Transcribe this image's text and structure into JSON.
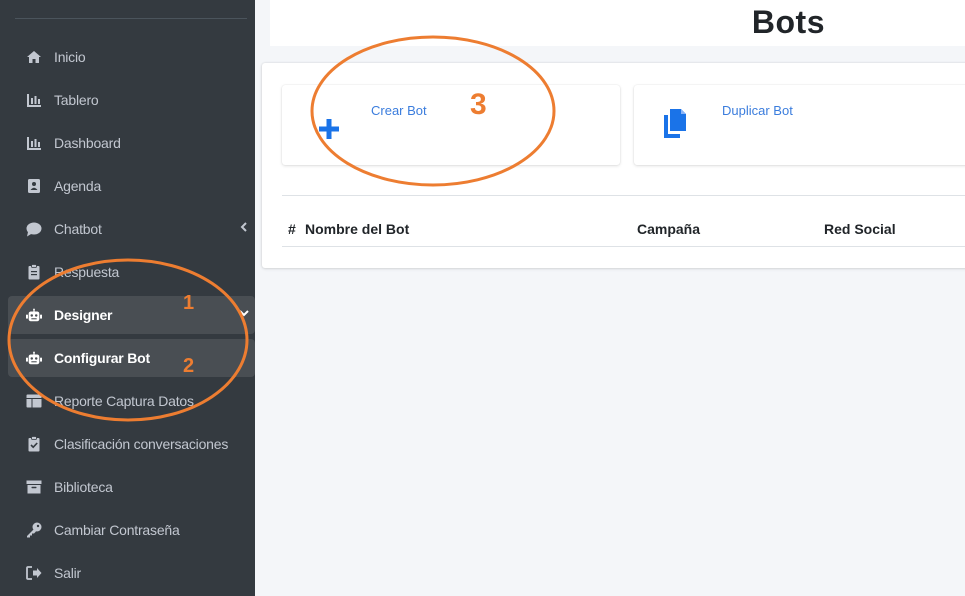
{
  "sidebar": {
    "items": [
      {
        "label": "Inicio",
        "icon": "home-icon"
      },
      {
        "label": "Tablero",
        "icon": "bar-chart-icon"
      },
      {
        "label": "Dashboard",
        "icon": "bar-chart-icon"
      },
      {
        "label": "Agenda",
        "icon": "address-book-icon"
      },
      {
        "label": "Chatbot",
        "icon": "chat-bubble-icon"
      },
      {
        "label": "Respuesta",
        "icon": "clipboard-icon"
      },
      {
        "label": "Designer",
        "icon": "robot-icon"
      },
      {
        "label": "Configurar Bot",
        "icon": "robot-icon"
      },
      {
        "label": "Reporte Captura Datos",
        "icon": "table-icon"
      },
      {
        "label": "Clasificación conversaciones",
        "icon": "clipboard-check-icon"
      },
      {
        "label": "Biblioteca",
        "icon": "archive-icon"
      },
      {
        "label": "Cambiar Contraseña",
        "icon": "key-icon"
      },
      {
        "label": "Salir",
        "icon": "sign-out-icon"
      }
    ]
  },
  "header": {
    "title": "Bots"
  },
  "actions": {
    "crear": {
      "label": "Crear Bot"
    },
    "duplicar": {
      "label": "Duplicar Bot"
    }
  },
  "table": {
    "columns": [
      "#",
      "Nombre del Bot",
      "Campaña",
      "Red Social"
    ]
  },
  "annotations": {
    "markers": [
      "1",
      "2",
      "3"
    ],
    "color": "#ed7d31"
  },
  "colors": {
    "sidebar_bg": "#343a40",
    "sidebar_active": "#494e53",
    "link_blue": "#3b7ddd",
    "icon_blue": "#1a73e8"
  }
}
